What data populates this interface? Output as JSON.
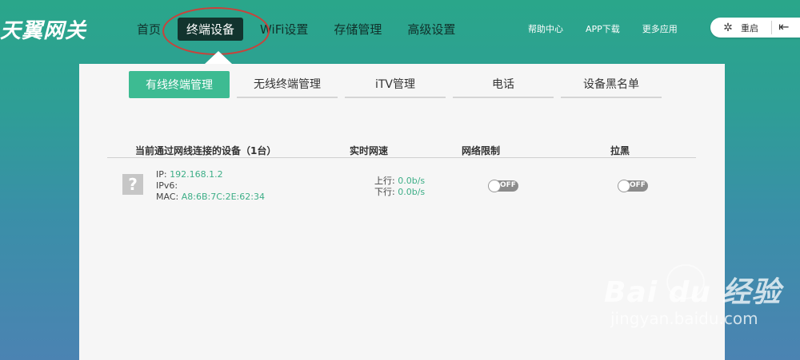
{
  "logo": "天翼网关",
  "nav": {
    "items": [
      {
        "label": "首页"
      },
      {
        "label": "终端设备"
      },
      {
        "label": "WiFi设置"
      },
      {
        "label": "存储管理"
      },
      {
        "label": "高级设置"
      }
    ],
    "active": "终端设备"
  },
  "header_links": [
    {
      "label": "帮助中心"
    },
    {
      "label": "APP下载"
    },
    {
      "label": "更多应用"
    }
  ],
  "restart_label": "重启",
  "tabs": [
    {
      "label": "有线终端管理"
    },
    {
      "label": "无线终端管理"
    },
    {
      "label": "iTV管理"
    },
    {
      "label": "电话"
    },
    {
      "label": "设备黑名单"
    }
  ],
  "table": {
    "headers": {
      "devices": "当前通过网线连接的设备（1台）",
      "speed": "实时网速",
      "limit": "网络限制",
      "block": "拉黑"
    },
    "rows": [
      {
        "ip_label": "IP:",
        "ip": "192.168.1.2",
        "ipv6_label": "IPv6:",
        "ipv6": "",
        "mac_label": "MAC:",
        "mac": "A8:6B:7C:2E:62:34",
        "up_label": "上行:",
        "up": "0.0b/s",
        "down_label": "下行:",
        "down": "0.0b/s",
        "limit_toggle": "OFF",
        "block_toggle": "OFF"
      }
    ]
  },
  "watermark": {
    "brand": "Bai du 经验",
    "url": "jingyan.baidu.com"
  },
  "colors": {
    "accent": "#3dbb92",
    "nav_active_bg": "#12342e",
    "annotation_circle": "#c9423b",
    "value_green": "#3dae87"
  }
}
